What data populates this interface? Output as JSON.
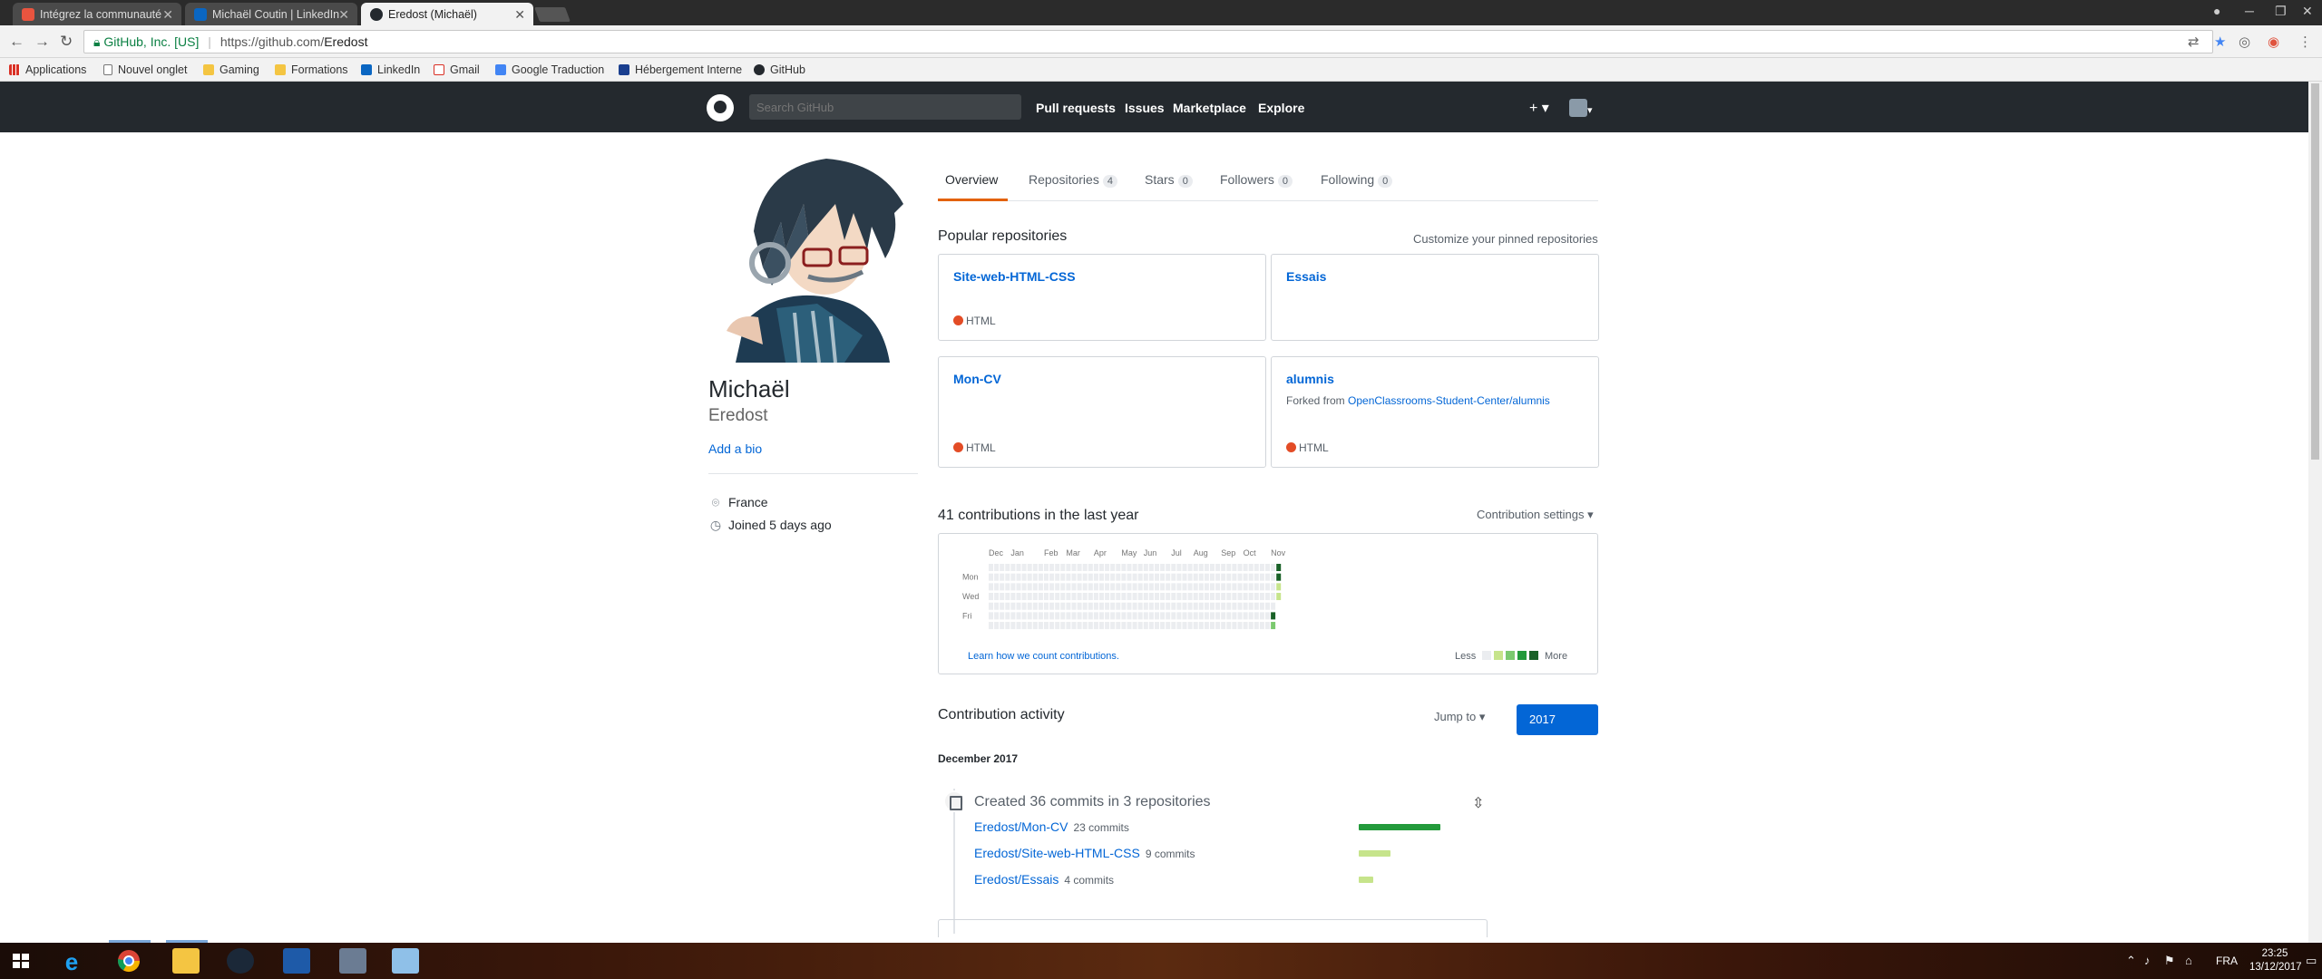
{
  "browser": {
    "tabs": [
      {
        "title": "Intégrez la communauté",
        "color": "#e8543f"
      },
      {
        "title": "Michaël Coutin | LinkedIn",
        "color": "#0a66c2"
      },
      {
        "title": "Eredost (Michaël)",
        "color": "#ffffff"
      }
    ],
    "site_identity": "GitHub, Inc. [US]",
    "url_prefix": "https://github.com/",
    "url_path": "Eredost",
    "bookmarks": [
      {
        "label": "Applications",
        "icon": "apps-grid-icon"
      },
      {
        "label": "Nouvel onglet",
        "icon": "page-icon"
      },
      {
        "label": "Gaming",
        "icon": "folder-icon"
      },
      {
        "label": "Formations",
        "icon": "folder-icon"
      },
      {
        "label": "LinkedIn",
        "icon": "linkedin-icon"
      },
      {
        "label": "Gmail",
        "icon": "gmail-icon"
      },
      {
        "label": "Google Traduction",
        "icon": "translate-icon"
      },
      {
        "label": "Hébergement Interne",
        "icon": "hosting-icon"
      },
      {
        "label": "GitHub",
        "icon": "github-icon"
      }
    ]
  },
  "github_header": {
    "search_placeholder": "Search GitHub",
    "nav": [
      "Pull requests",
      "Issues",
      "Marketplace",
      "Explore"
    ],
    "plus_label": "+ ▾",
    "avatar_label": "▾"
  },
  "profile": {
    "fullname": "Michaël",
    "username": "Eredost",
    "add_bio": "Add a bio",
    "location": "France",
    "joined": "Joined 5 days ago"
  },
  "profile_tabs": [
    {
      "label": "Overview",
      "count": null
    },
    {
      "label": "Repositories",
      "count": "4"
    },
    {
      "label": "Stars",
      "count": "0"
    },
    {
      "label": "Followers",
      "count": "0"
    },
    {
      "label": "Following",
      "count": "0"
    }
  ],
  "pinned": {
    "title": "Popular repositories",
    "customize": "Customize your pinned repositories",
    "repos": [
      {
        "name": "Site-web-HTML-CSS",
        "language": "HTML",
        "fork_prefix": "",
        "fork_source": ""
      },
      {
        "name": "Essais",
        "language": "",
        "fork_prefix": "",
        "fork_source": ""
      },
      {
        "name": "Mon-CV",
        "language": "HTML",
        "fork_prefix": "",
        "fork_source": ""
      },
      {
        "name": "alumnis",
        "language": "HTML",
        "fork_prefix": "Forked from ",
        "fork_source": "OpenClassrooms-Student-Center/alumnis"
      }
    ],
    "language_color": "#e34c26"
  },
  "contributions": {
    "title": "41 contributions in the last year",
    "settings": "Contribution settings ▾",
    "months": [
      "Dec",
      "Jan",
      "Feb",
      "Mar",
      "Apr",
      "May",
      "Jun",
      "Jul",
      "Aug",
      "Sep",
      "Oct",
      "Nov"
    ],
    "days": [
      "Mon",
      "Wed",
      "Fri"
    ],
    "learn": "Learn how we count contributions.",
    "less": "Less",
    "more": "More",
    "colors": [
      "#ebedf0",
      "#c6e48b",
      "#7bc96f",
      "#239a3b",
      "#196127"
    ],
    "week_count": 53,
    "recent_levels": {
      "week_52": [
        0,
        0,
        0,
        0,
        0,
        4,
        2
      ],
      "week_53": [
        4,
        4,
        1,
        1,
        0,
        0,
        0
      ]
    }
  },
  "activity": {
    "title": "Contribution activity",
    "jump_to": "Jump to ▾",
    "year": "2017",
    "month": "December 2017",
    "summary": "Created 36 commits in 3 repositories",
    "repos": [
      {
        "name": "Eredost/Mon-CV",
        "commits": "23 commits",
        "value": 23,
        "color": "#239a3b"
      },
      {
        "name": "Eredost/Site-web-HTML-CSS",
        "commits": "9 commits",
        "value": 9,
        "color": "#c6e48b"
      },
      {
        "name": "Eredost/Essais",
        "commits": "4 commits",
        "value": 4,
        "color": "#c6e48b"
      }
    ]
  },
  "taskbar": {
    "lang": "FRA",
    "time": "23:25",
    "date": "13/12/2017"
  }
}
